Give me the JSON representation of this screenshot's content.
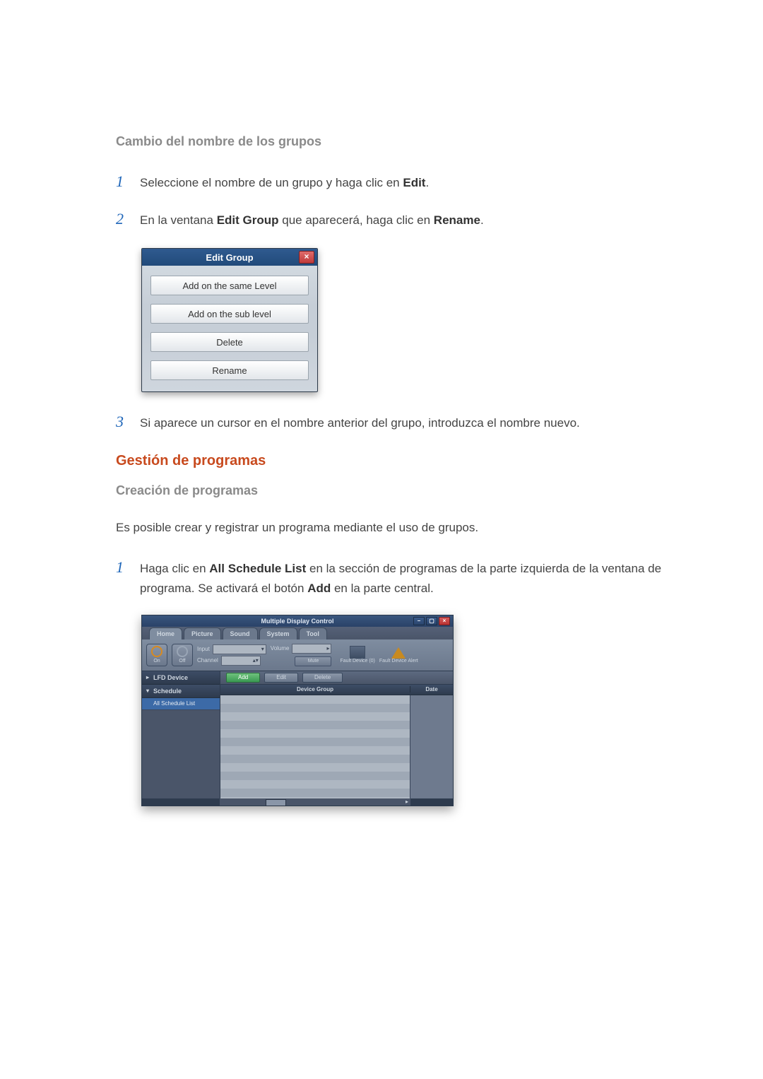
{
  "headings": {
    "rename_groups": "Cambio del nombre de los grupos",
    "manage_programs": "Gestión de programas",
    "create_programs": "Creación de programas"
  },
  "steps_rename": [
    {
      "num": "1",
      "pre": "Seleccione el nombre de un grupo y haga clic en ",
      "b1": "Edit",
      "post": "."
    },
    {
      "num": "2",
      "pre": "En la ventana ",
      "b1": "Edit Group",
      "mid": " que aparecerá, haga clic en ",
      "b2": "Rename",
      "post": "."
    },
    {
      "num": "3",
      "pre": "Si aparece un cursor en el nombre anterior del grupo, introduzca el nombre nuevo."
    }
  ],
  "edit_group_dialog": {
    "title": "Edit Group",
    "close": "×",
    "buttons": [
      "Add on the same Level",
      "Add on the sub level",
      "Delete",
      "Rename"
    ]
  },
  "intro_create": "Es posible crear y registrar un programa mediante el uso de grupos.",
  "steps_create": [
    {
      "num": "1",
      "pre": "Haga clic en ",
      "b1": "All Schedule List",
      "mid": " en la sección de programas de la parte izquierda de la ventana de programa. Se activará el botón ",
      "b2": "Add",
      "post": " en la parte central."
    }
  ],
  "mdc": {
    "title": "Multiple Display Control",
    "win": {
      "min": "–",
      "max": "▢",
      "close": "×",
      "help": "?"
    },
    "tabs": [
      "Home",
      "Picture",
      "Sound",
      "System",
      "Tool"
    ],
    "ribbon": {
      "power_on": "On",
      "power_off": "Off",
      "input_label": "Input",
      "channel_label": "Channel",
      "volume_label": "Volume",
      "mute": "Mute",
      "fault0": "Fault Device (0)",
      "fault_alert": "Fault Device Alert"
    },
    "side": {
      "lfd": "LFD Device",
      "schedule": "Schedule",
      "all_schedule": "All Schedule List"
    },
    "actions": {
      "add": "Add",
      "edit": "Edit",
      "delete": "Delete"
    },
    "columns": {
      "device_group": "Device Group",
      "date": "Date"
    }
  }
}
